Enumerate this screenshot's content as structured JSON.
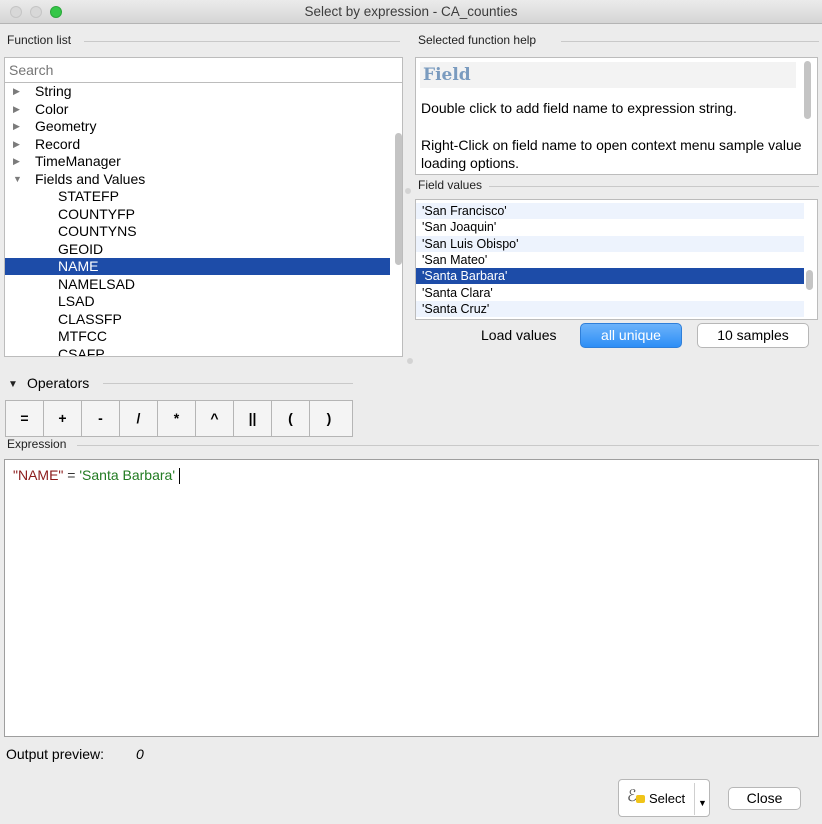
{
  "window": {
    "title": "Select by expression - CA_counties"
  },
  "function_list": {
    "label": "Function list",
    "search_placeholder": "Search",
    "categories": [
      {
        "label": "String",
        "arrow": "▶"
      },
      {
        "label": "Color",
        "arrow": "▶"
      },
      {
        "label": "Geometry",
        "arrow": "▶"
      },
      {
        "label": "Record",
        "arrow": "▶"
      },
      {
        "label": "TimeManager",
        "arrow": "▶"
      },
      {
        "label": "Fields and Values",
        "arrow": "▼"
      }
    ],
    "fields": [
      "STATEFP",
      "COUNTYFP",
      "COUNTYNS",
      "GEOID",
      "NAME",
      "NAMELSAD",
      "LSAD",
      "CLASSFP",
      "MTFCC",
      "CSAFP"
    ],
    "selected_field": "NAME"
  },
  "help": {
    "label": "Selected function help",
    "title": "Field",
    "paragraph1": "Double click to add field name to expression string.",
    "paragraph2": "Right-Click on field name to open context menu sample value loading options."
  },
  "field_values": {
    "label": "Field values",
    "items": [
      "'San Francisco'",
      "'San Joaquin'",
      "'San Luis Obispo'",
      "'San Mateo'",
      "'Santa Barbara'",
      "'Santa Clara'",
      "'Santa Cruz'"
    ],
    "selected": "'Santa Barbara'",
    "load_label": "Load values",
    "all_unique_label": "all unique",
    "samples_label": "10 samples"
  },
  "operators": {
    "label": "Operators",
    "arrow": "▼",
    "items": [
      "=",
      "+",
      "-",
      "/",
      "*",
      "^",
      "||",
      "(",
      ")"
    ]
  },
  "expression": {
    "label": "Expression",
    "field": "\"NAME\"",
    "operator": " = ",
    "value": "'Santa Barbara'"
  },
  "output": {
    "label": "Output preview:",
    "value": "0"
  },
  "buttons": {
    "select_label": "Select",
    "select_icon_glyph": "ℰ",
    "dropdown_glyph": "▼",
    "close_label": "Close"
  },
  "colors": {
    "selection": "#1d4ca8",
    "accent_button": "#2d8ef6",
    "field_token": "#8b1a1a",
    "string_token": "#217b21",
    "help_title": "#7a9bbf"
  }
}
